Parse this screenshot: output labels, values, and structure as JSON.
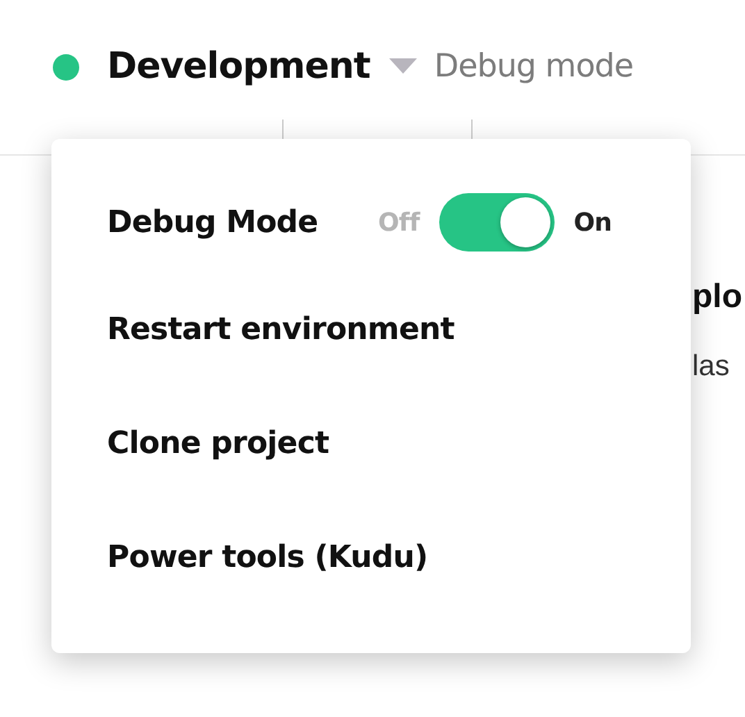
{
  "environment": {
    "name": "Development",
    "mode": "Debug mode"
  },
  "background": {
    "heading_fragment": "plo",
    "text_fragment": "las"
  },
  "menu": {
    "items": [
      {
        "kind": "toggle",
        "label": "Debug Mode",
        "off_label": "Off",
        "on_label": "On",
        "on": true
      },
      {
        "kind": "action",
        "label": "Restart environment"
      },
      {
        "kind": "action",
        "label": "Clone project"
      },
      {
        "kind": "action",
        "label": "Power tools (Kudu)"
      }
    ]
  }
}
